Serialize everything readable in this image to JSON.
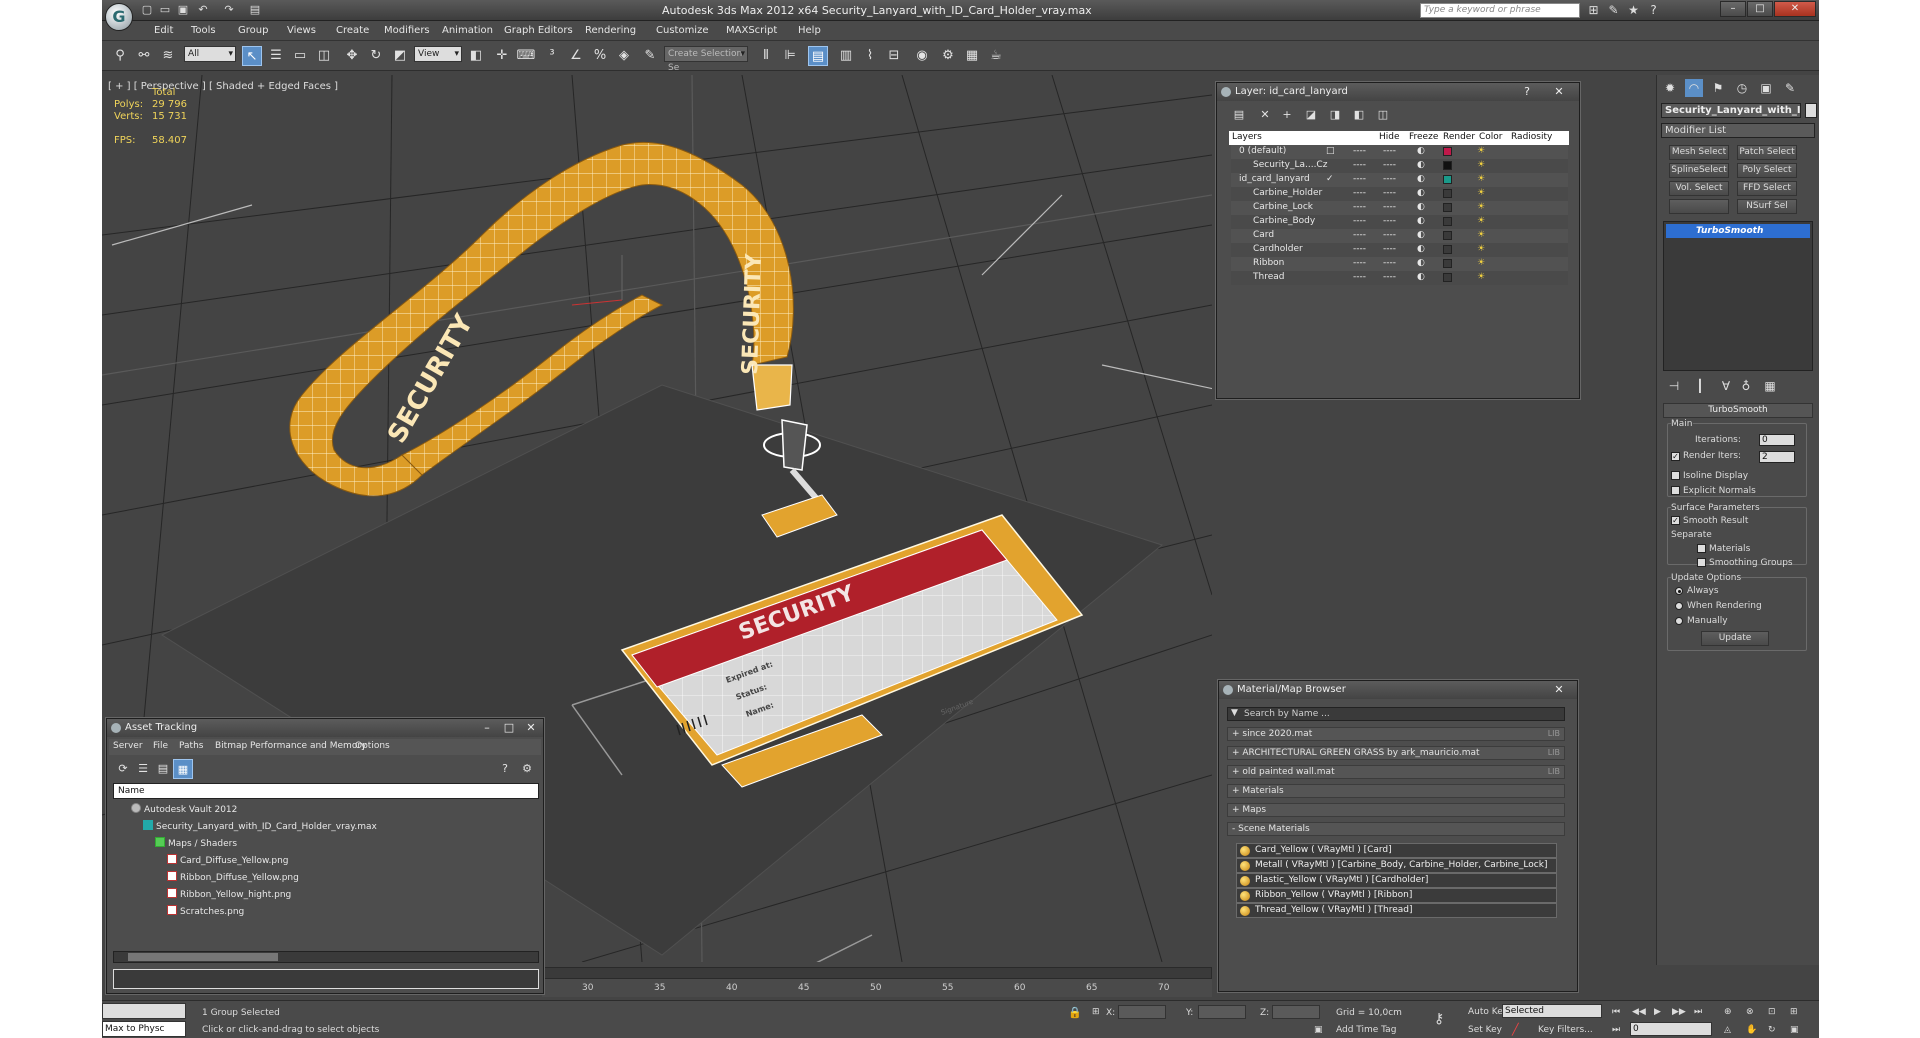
{
  "app": {
    "title": "Autodesk 3ds Max  2012 x64      Security_Lanyard_with_ID_Card_Holder_vray.max",
    "search_placeholder": "Type a keyword or phrase"
  },
  "menu": [
    "Edit",
    "Tools",
    "Group",
    "Views",
    "Create",
    "Modifiers",
    "Animation",
    "Graph Editors",
    "Rendering",
    "Customize",
    "MAXScript",
    "Help"
  ],
  "toolbar": {
    "selection_filter": "All",
    "ref_coord": "View",
    "named_selection_placeholder": "Create Selection Se"
  },
  "viewport": {
    "label": "[ + ] [ Perspective ] [ Shaded + Edged Faces ]",
    "stats": {
      "header": "Total",
      "polys_label": "Polys:",
      "polys": "29 796",
      "verts_label": "Verts:",
      "verts": "15 731",
      "fps_label": "FPS:",
      "fps": "58.407"
    },
    "strap_text": "SECURITY",
    "card_title": "SECURITY",
    "card_fields": [
      "Expired at:",
      "Status:",
      "Name:"
    ],
    "card_signature": "Signature"
  },
  "layer_window": {
    "title": "Layer: id_card_lanyard",
    "columns": [
      "Layers",
      "Hide",
      "Freeze",
      "Render",
      "Color",
      "Radiosity"
    ],
    "rows": [
      {
        "name": "0 (default)",
        "indent": 0,
        "color": "#c0194a",
        "check": "□"
      },
      {
        "name": "Security_La....Cz",
        "indent": 1,
        "color": "#111111",
        "check": ""
      },
      {
        "name": "id_card_lanyard",
        "indent": 0,
        "color": "#1a9a8a",
        "check": "✓"
      },
      {
        "name": "Carbine_Holder",
        "indent": 1,
        "color": "#3a3a3a",
        "check": ""
      },
      {
        "name": "Carbine_Lock",
        "indent": 1,
        "color": "#3a3a3a",
        "check": ""
      },
      {
        "name": "Carbine_Body",
        "indent": 1,
        "color": "#3a3a3a",
        "check": ""
      },
      {
        "name": "Card",
        "indent": 1,
        "color": "#3a3a3a",
        "check": ""
      },
      {
        "name": "Cardholder",
        "indent": 1,
        "color": "#3a3a3a",
        "check": ""
      },
      {
        "name": "Ribbon",
        "indent": 1,
        "color": "#3a3a3a",
        "check": ""
      },
      {
        "name": "Thread",
        "indent": 1,
        "color": "#3a3a3a",
        "check": ""
      }
    ],
    "dots": "----"
  },
  "command_panel": {
    "object_name": "Security_Lanyard_with_I",
    "modifier_list": "Modifier List",
    "buttons": [
      "Mesh Select",
      "Patch Select",
      "SplineSelect",
      "Poly Select",
      "Vol. Select",
      "FFD Select",
      "",
      "NSurf Sel"
    ],
    "stack_item": "TurboSmooth",
    "rollout_title": "TurboSmooth",
    "main_label": "Main",
    "iterations_label": "Iterations:",
    "iterations": "0",
    "render_iters_label": "Render Iters:",
    "render_iters": "2",
    "isoline": "Isoline Display",
    "explicit_normals": "Explicit Normals",
    "surface_params": "Surface Parameters",
    "smooth_result": "Smooth Result",
    "separate": "Separate",
    "materials": "Materials",
    "smoothing_groups": "Smoothing Groups",
    "update_options": "Update Options",
    "always": "Always",
    "when_rendering": "When Rendering",
    "manually": "Manually",
    "update_btn": "Update"
  },
  "material_browser": {
    "title": "Material/Map Browser",
    "search_placeholder": "Search by Name ...",
    "groups": [
      {
        "label": "+ since 2020.mat",
        "lib": "LIB"
      },
      {
        "label": "+ ARCHITECTURAL GREEN GRASS by ark_mauricio.mat",
        "lib": "LIB"
      },
      {
        "label": "+ old painted wall.mat",
        "lib": "LIB"
      },
      {
        "label": "+ Materials",
        "lib": ""
      },
      {
        "label": "+ Maps",
        "lib": ""
      },
      {
        "label": "- Scene Materials",
        "lib": ""
      }
    ],
    "scene_materials": [
      "Card_Yellow  ( VRayMtl ) [Card]",
      "Metall  ( VRayMtl ) [Carbine_Body, Carbine_Holder, Carbine_Lock]",
      "Plastic_Yellow  ( VRayMtl ) [Cardholder]",
      "Ribbon_Yellow  ( VRayMtl ) [Ribbon]",
      "Thread_Yellow  ( VRayMtl ) [Thread]"
    ]
  },
  "asset_tracking": {
    "title": "Asset Tracking",
    "menu": [
      "Server",
      "File",
      "Paths",
      "Bitmap Performance and Memory",
      "Options"
    ],
    "column": "Name",
    "tree": [
      {
        "label": "Autodesk Vault 2012",
        "indent": 0
      },
      {
        "label": "Security_Lanyard_with_ID_Card_Holder_vray.max",
        "indent": 1
      },
      {
        "label": "Maps / Shaders",
        "indent": 2
      },
      {
        "label": "Card_Diffuse_Yellow.png",
        "indent": 3
      },
      {
        "label": "Ribbon_Diffuse_Yellow.png",
        "indent": 3
      },
      {
        "label": "Ribbon_Yellow_hight.png",
        "indent": 3
      },
      {
        "label": "Scratches.png",
        "indent": 3
      }
    ]
  },
  "timeline": {
    "ticks": [
      "30",
      "35",
      "40",
      "45",
      "50",
      "55",
      "60",
      "65",
      "70"
    ]
  },
  "status": {
    "maxscript": "Max to Physc",
    "selected": "1 Group Selected",
    "prompt": "Click or click-and-drag to select objects",
    "x_label": "X:",
    "y_label": "Y:",
    "z_label": "Z:",
    "grid": "Grid = 10,0cm",
    "add_time_tag": "Add Time Tag",
    "auto_key": "Auto Key",
    "set_key": "Set Key",
    "key_mode": "Selected",
    "key_filters": "Key Filters...",
    "frame": "0"
  },
  "colors": {
    "accent": "#5b8fc7",
    "strap": "#e0a12a",
    "card_red": "#b0202a"
  }
}
